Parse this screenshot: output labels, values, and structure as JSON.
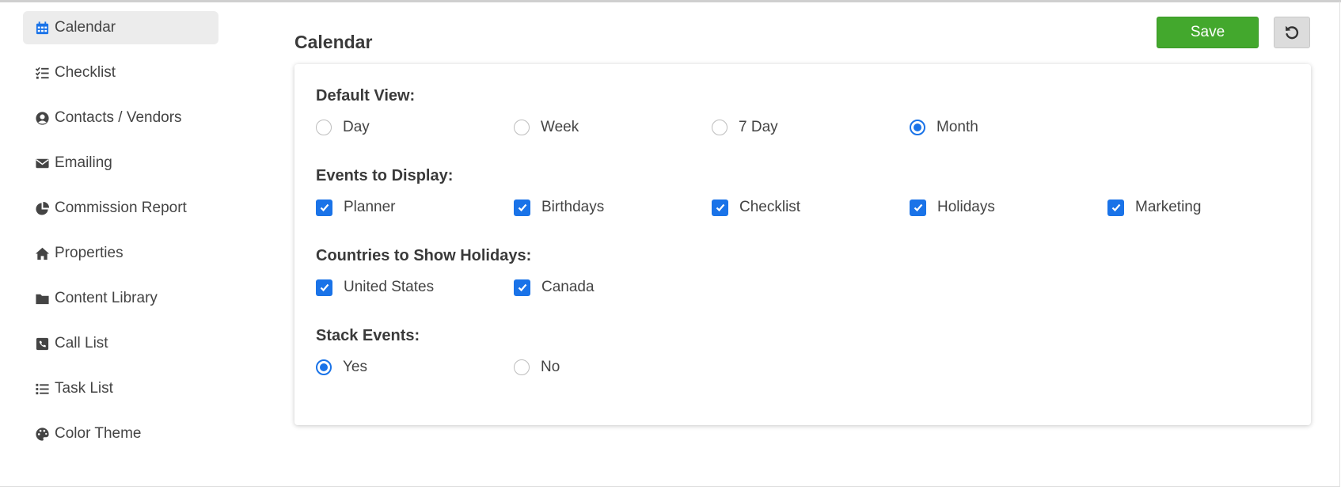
{
  "sidebar": {
    "items": [
      {
        "label": "Calendar",
        "icon": "calendar-icon",
        "active": true
      },
      {
        "label": "Checklist",
        "icon": "checklist-icon"
      },
      {
        "label": "Contacts / Vendors",
        "icon": "user-circle-icon"
      },
      {
        "label": "Emailing",
        "icon": "envelope-icon"
      },
      {
        "label": "Commission Report",
        "icon": "pie-chart-icon"
      },
      {
        "label": "Properties",
        "icon": "home-icon"
      },
      {
        "label": "Content Library",
        "icon": "folder-icon"
      },
      {
        "label": "Call List",
        "icon": "phone-square-icon"
      },
      {
        "label": "Task List",
        "icon": "list-icon"
      },
      {
        "label": "Color Theme",
        "icon": "palette-icon"
      }
    ]
  },
  "header": {
    "title": "Calendar",
    "save_label": "Save",
    "reset_icon": "undo-icon"
  },
  "settings": {
    "default_view": {
      "label": "Default View:",
      "options": [
        "Day",
        "Week",
        "7 Day",
        "Month"
      ],
      "selected": "Month"
    },
    "events_to_display": {
      "label": "Events to Display:",
      "options": [
        {
          "label": "Planner",
          "checked": true
        },
        {
          "label": "Birthdays",
          "checked": true
        },
        {
          "label": "Checklist",
          "checked": true
        },
        {
          "label": "Holidays",
          "checked": true
        },
        {
          "label": "Marketing",
          "checked": true
        }
      ]
    },
    "countries": {
      "label": "Countries to Show Holidays:",
      "options": [
        {
          "label": "United States",
          "checked": true
        },
        {
          "label": "Canada",
          "checked": true
        }
      ]
    },
    "stack_events": {
      "label": "Stack Events:",
      "options": [
        "Yes",
        "No"
      ],
      "selected": "Yes"
    }
  },
  "colors": {
    "accent": "#1a73e8",
    "save": "#43a82d",
    "active_sidebar": "#ececec"
  }
}
